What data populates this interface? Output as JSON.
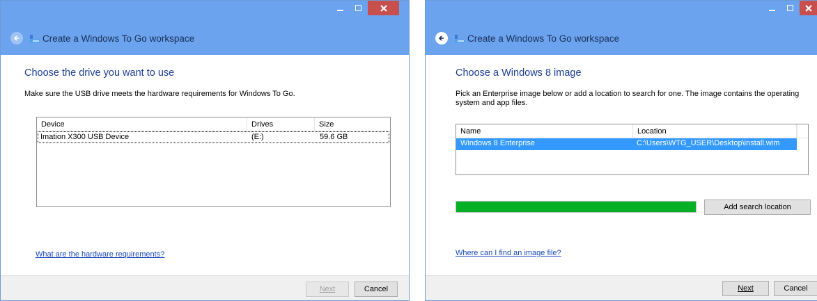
{
  "left_window": {
    "header_title": "Create a Windows To Go workspace",
    "heading": "Choose the drive you want to use",
    "description": "Make sure the USB drive meets the hardware requirements for Windows To Go.",
    "table": {
      "columns": [
        "Device",
        "Drives",
        "Size"
      ],
      "rows": [
        {
          "device": "Imation X300 USB Device",
          "drives": "(E:)",
          "size": "59.6 GB"
        }
      ]
    },
    "link": "What are the hardware requirements?",
    "next_label": "Next",
    "cancel_label": "Cancel"
  },
  "right_window": {
    "header_title": "Create a Windows To Go workspace",
    "heading": "Choose a Windows 8 image",
    "description": "Pick an Enterprise image below or add a location to search for one. The image contains the operating system and app files.",
    "table": {
      "columns": [
        "Name",
        "Location"
      ],
      "rows": [
        {
          "name": "Windows 8 Enterprise",
          "location": "C:\\Users\\WTG_USER\\Desktop\\install.wim"
        }
      ]
    },
    "progress_fraction": 1.0,
    "add_search_label": "Add search location",
    "link": "Where can I find an image file?",
    "next_label": "Next",
    "cancel_label": "Cancel"
  },
  "colors": {
    "titlebar": "#6ba3ef",
    "close_button": "#c7504f",
    "heading": "#1c3d91",
    "link": "#1a47b4",
    "selection": "#3399ff",
    "progress": "#06b025"
  },
  "icons": [
    "back-arrow-icon",
    "usb-drive-icon",
    "minimize-icon",
    "maximize-icon",
    "close-icon"
  ]
}
